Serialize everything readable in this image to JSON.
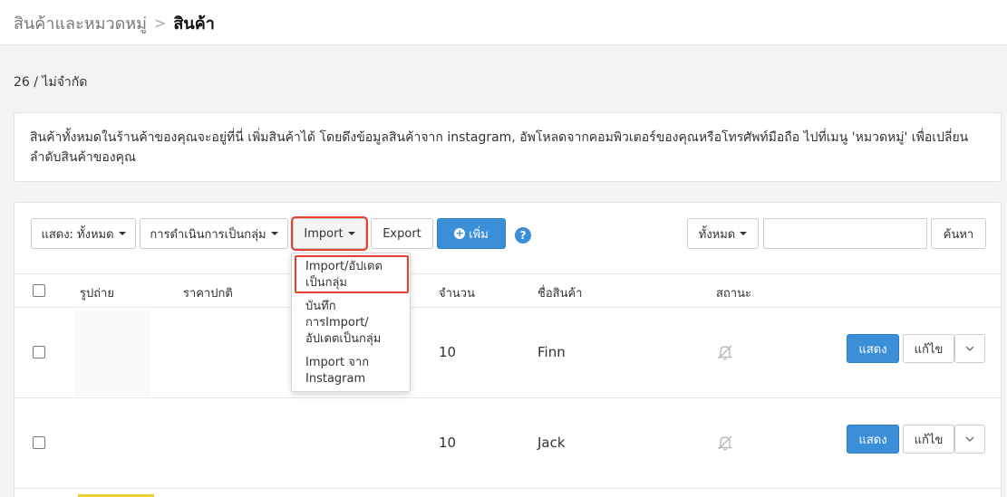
{
  "breadcrumb": {
    "parent": "สินค้าและหมวดหมู่",
    "separator": ">",
    "current": "สินค้า"
  },
  "count_text": "26 / ไม่จำกัด",
  "notice": "สินค้าทั้งหมดในร้านค้าของคุณจะอยู่ที่นี่ เพิ่มสินค้าได้ โดยดึงข้อมูลสินค้าจาก instagram, อัพโหลดจากคอมพิวเตอร์ของคุณหรือโทรศัพท์มือถือ ไปที่เมนู 'หมวดหมู่' เพื่อเปลี่ยนลำดับสินค้าของคุณ",
  "toolbar": {
    "show_label": "แสดง: ทั้งหมด",
    "bulk_label": "การดำเนินการเป็นกลุ่ม",
    "import_label": "Import",
    "export_label": "Export",
    "add_label": "เพิ่ม",
    "help": "?",
    "filter_label": "ทั้งหมด",
    "search_button": "ค้นหา",
    "search_value": ""
  },
  "table": {
    "headers": {
      "photo": "รูปถ่าย",
      "price": "ราคาปกติ",
      "qty": "จำนวน",
      "name": "ชื่อสินค้า",
      "status": "สถานะ"
    },
    "rows": [
      {
        "qty": "10",
        "name": "Finn",
        "show": "แสดง",
        "edit": "แก้ไข"
      },
      {
        "qty": "10",
        "name": "Jack",
        "show": "แสดง",
        "edit": "แก้ไข"
      }
    ]
  },
  "import_menu": {
    "items": [
      {
        "line1": "Import/อัปเดต",
        "line2": "เป็นกลุ่ม"
      },
      {
        "line1": "บันทึก",
        "line2": "การImport/",
        "line3": "อัปเดตเป็นกลุ่ม"
      },
      {
        "line1": "Import จาก",
        "line2": "Instagram"
      }
    ]
  },
  "colors": {
    "primary": "#3b8ed8",
    "highlight": "#e3402f",
    "background": "#f3f3f3"
  },
  "icons": [
    "chevron-right-icon",
    "caret-down-icon",
    "plus-circle-icon",
    "help-icon",
    "bell-off-icon"
  ]
}
